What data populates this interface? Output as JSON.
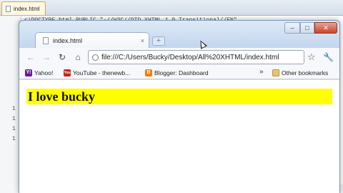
{
  "editor": {
    "tab_label": "index.html",
    "code_peek": "<!DOCTYPE html PUBLIC \"-//W3C//DTD XHTML 1.0 Transitional//EN\"",
    "line_numbers": [
      "1",
      "1",
      "1",
      "1"
    ]
  },
  "browser": {
    "tab_title": "index.html",
    "tab_close": "×",
    "new_tab": "+",
    "window_controls": {
      "minimize": "–",
      "maximize": "□",
      "close": "✕"
    },
    "nav": {
      "back": "←",
      "forward": "→",
      "reload": "↻",
      "home": "⌂"
    },
    "url": "file:///C:/Users/Bucky/Desktop/All%20XHTML/index.html",
    "bookmark_star": "☆",
    "wrench": "🔧",
    "bookmarks": [
      {
        "label": "Yahoo!",
        "icon": "yahoo-icon",
        "glyph": "Y!"
      },
      {
        "label": "YouTube - thenewb...",
        "icon": "youtube-icon",
        "glyph": "You"
      },
      {
        "label": "Blogger: Dashboard",
        "icon": "blogger-icon",
        "glyph": "B"
      }
    ],
    "bookmarks_overflow": "»",
    "other_bookmarks": "Other bookmarks"
  },
  "page": {
    "heading": "I love bucky",
    "heading_background": "#ffff00"
  }
}
